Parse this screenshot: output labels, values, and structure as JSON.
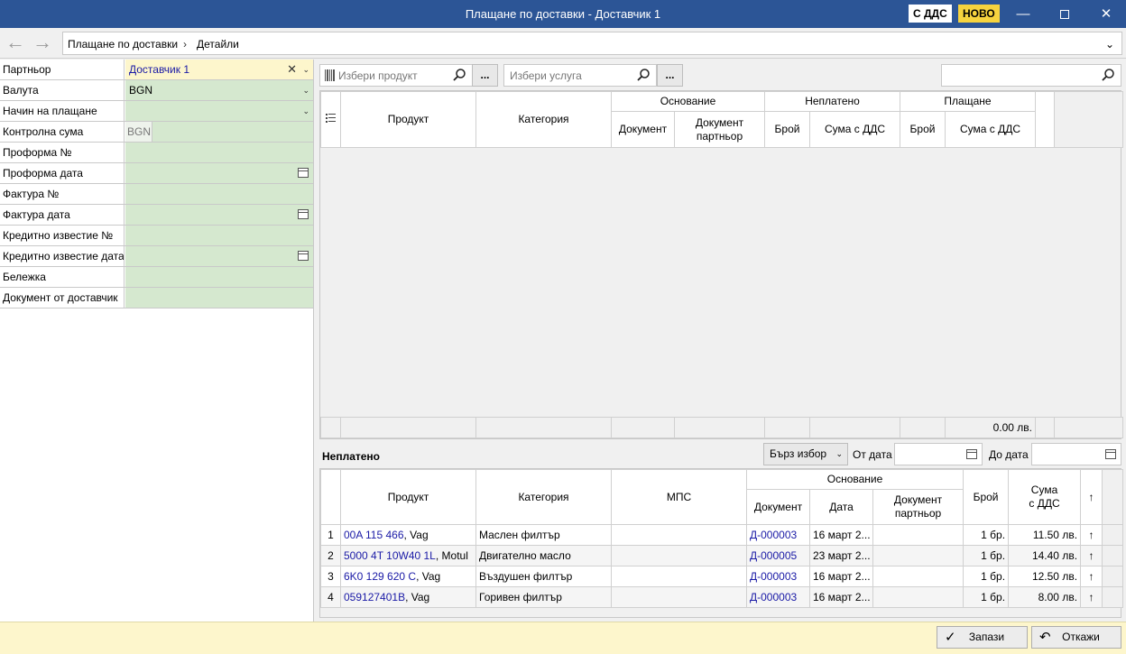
{
  "window": {
    "title": "Плащане по доставки - Доставчик 1",
    "vat_badge": "С ДДС",
    "new_badge": "НОВО"
  },
  "breadcrumb": [
    "Плащане по доставки",
    "Детайли"
  ],
  "form": [
    {
      "label": "Партньор",
      "value": "Доставчик 1",
      "kind": "partner"
    },
    {
      "label": "Валута",
      "value": "BGN",
      "kind": "dropdown"
    },
    {
      "label": "Начин на плащане",
      "value": "",
      "kind": "dropdown"
    },
    {
      "label": "Контролна сума",
      "value": "BGN",
      "kind": "sum"
    },
    {
      "label": "Проформа №",
      "value": "",
      "kind": "text"
    },
    {
      "label": "Проформа дата",
      "value": "",
      "kind": "date"
    },
    {
      "label": "Фактура №",
      "value": "",
      "kind": "text"
    },
    {
      "label": "Фактура дата",
      "value": "",
      "kind": "date"
    },
    {
      "label": "Кредитно известие №",
      "value": "",
      "kind": "text"
    },
    {
      "label": "Кредитно известие дата",
      "value": "",
      "kind": "date"
    },
    {
      "label": "Бележка",
      "value": "",
      "kind": "text"
    },
    {
      "label": "Документ от доставчик",
      "value": "",
      "kind": "text"
    }
  ],
  "search": {
    "product_placeholder": "Избери продукт",
    "service_placeholder": "Избери услуга",
    "ellipsis": "...",
    "global_placeholder": ""
  },
  "payment_grid": {
    "headers": {
      "product": "Продукт",
      "category": "Категория",
      "basis": "Основание",
      "document": "Документ",
      "partner_doc": "Документ партньор",
      "unpaid": "Неплатено",
      "count": "Брой",
      "sum_vat": "Сума с ДДС",
      "paid": "Плащане"
    },
    "total": "0.00 лв."
  },
  "unpaid": {
    "section_label": "Неплатено",
    "quick_select": "Бърз избор",
    "from_label": "От дата",
    "to_label": "До дата",
    "headers": {
      "product": "Продукт",
      "category": "Категория",
      "mps": "МПС",
      "basis": "Основание",
      "document": "Документ",
      "date": "Дата",
      "partner_doc": "Документ партньор",
      "count": "Брой",
      "sum_vat_1": "Сума",
      "sum_vat_2": "с ДДС"
    },
    "rows": [
      {
        "n": "1",
        "code": "00A 115 466",
        "brand": ", Vag",
        "category": "Маслен филтър",
        "mps": "",
        "doc": "Д-000003",
        "date": "16 март 2...",
        "pdoc": "",
        "count": "1 бр.",
        "sum": "11.50 лв."
      },
      {
        "n": "2",
        "code": "5000 4T 10W40 1L",
        "brand": ", Motul",
        "category": "Двигателно масло",
        "mps": "",
        "doc": "Д-000005",
        "date": "23 март 2...",
        "pdoc": "",
        "count": "1 бр.",
        "sum": "14.40 лв."
      },
      {
        "n": "3",
        "code": "6K0 129 620 C",
        "brand": ", Vag",
        "category": "Въздушен филтър",
        "mps": "",
        "doc": "Д-000003",
        "date": "16 март 2...",
        "pdoc": "",
        "count": "1 бр.",
        "sum": "12.50 лв."
      },
      {
        "n": "4",
        "code": "059127401B",
        "brand": ", Vag",
        "category": "Горивен филтър",
        "mps": "",
        "doc": "Д-000003",
        "date": "16 март 2...",
        "pdoc": "",
        "count": "1 бр.",
        "sum": "8.00 лв."
      }
    ]
  },
  "buttons": {
    "save": "Запази",
    "cancel": "Откажи"
  },
  "colors": {
    "titlebar": "#2c5596",
    "field_bg": "#d5e8cf",
    "partner_bg": "#fdf6cc",
    "link": "#1a1aa6",
    "statusbar": "#fdf6cc"
  }
}
